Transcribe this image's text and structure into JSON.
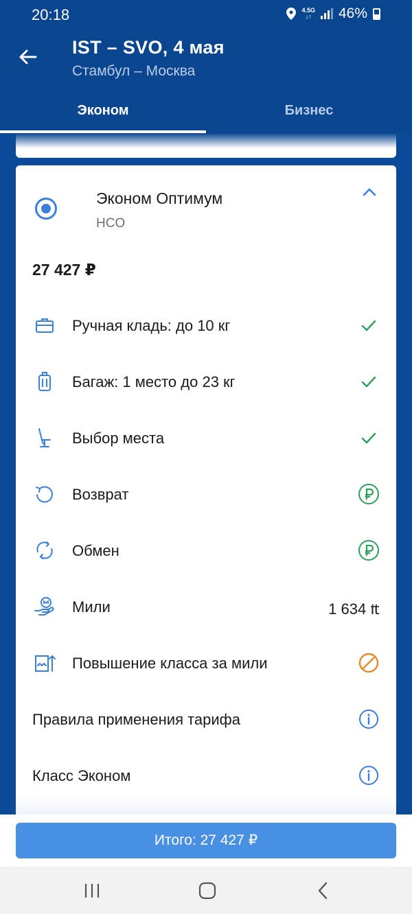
{
  "status_bar": {
    "time": "20:18",
    "network_top": "4.5G",
    "network_bottom": "↓↑",
    "battery": "46%"
  },
  "header": {
    "route": "IST – SVO, 4 мая",
    "cities": "Стамбул – Москва",
    "tabs": [
      {
        "label": "Эконом",
        "active": true
      },
      {
        "label": "Бизнес",
        "active": false
      }
    ]
  },
  "fare": {
    "name": "Эконом Оптимум",
    "code": "HCO",
    "price": "27 427 ₽",
    "features": [
      {
        "label": "Ручная кладь: до 10 кг",
        "icon": "briefcase-icon",
        "status": "check"
      },
      {
        "label": "Багаж: 1 место до 23 кг",
        "icon": "suitcase-icon",
        "status": "check"
      },
      {
        "label": "Выбор места",
        "icon": "seat-icon",
        "status": "check"
      },
      {
        "label": "Возврат",
        "icon": "refund-icon",
        "status": "ruble"
      },
      {
        "label": "Обмен",
        "icon": "exchange-icon",
        "status": "ruble"
      },
      {
        "label": "Мили",
        "icon": "miles-icon",
        "value": "1 634 ₶"
      },
      {
        "label": "Повышение класса за мили",
        "icon": "upgrade-icon",
        "status": "not-available"
      },
      {
        "label": "Правила применения тарифа",
        "status": "info"
      },
      {
        "label": "Класс Эконом",
        "status": "info"
      }
    ]
  },
  "total_button": "Итого: 27 427 ₽",
  "colors": {
    "header_blue": "#0a4690",
    "accent_blue": "#3a7fd8",
    "button_blue": "#4a90e2",
    "check_green": "#2e9e5b",
    "warning_orange": "#e58a2b"
  }
}
